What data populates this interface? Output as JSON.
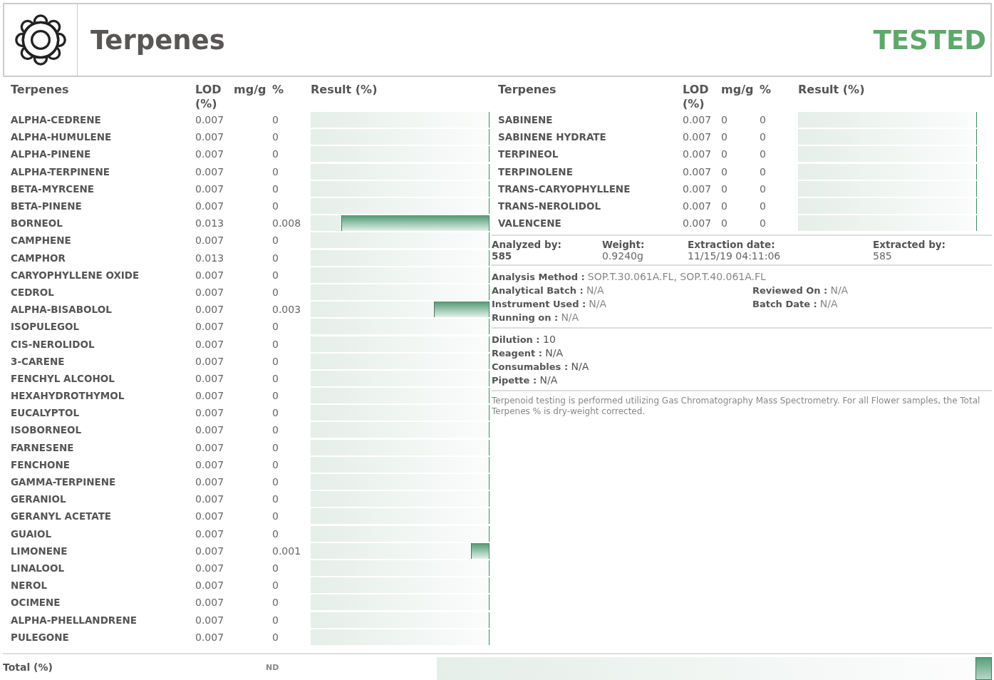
{
  "header": {
    "title": "Terpenes",
    "status": "TESTED"
  },
  "left_table": {
    "columns": [
      "Terpenes",
      "LOD (%)",
      "mg/g",
      "%",
      "Result (%)"
    ],
    "rows": [
      {
        "name": "ALPHA-CEDRENE",
        "lod": "0.007",
        "percent": "0"
      },
      {
        "name": "ALPHA-HUMULENE",
        "lod": "0.007",
        "percent": "0"
      },
      {
        "name": "ALPHA-PINENE",
        "lod": "0.007",
        "percent": "0"
      },
      {
        "name": "ALPHA-TERPINENE",
        "lod": "0.007",
        "percent": "0"
      },
      {
        "name": "BETA-MYRCENE",
        "lod": "0.007",
        "percent": "0"
      },
      {
        "name": "BETA-PINENE",
        "lod": "0.007",
        "percent": "0"
      },
      {
        "name": "BORNEOL",
        "lod": "0.013",
        "percent": "0.008",
        "level": 0.83
      },
      {
        "name": "CAMPHENE",
        "lod": "0.007",
        "percent": "0"
      },
      {
        "name": "CAMPHOR",
        "lod": "0.013",
        "percent": "0"
      },
      {
        "name": "CARYOPHYLLENE OXIDE",
        "lod": "0.007",
        "percent": "0"
      },
      {
        "name": "CEDROL",
        "lod": "0.007",
        "percent": "0"
      },
      {
        "name": "ALPHA-BISABOLOL",
        "lod": "0.007",
        "percent": "0.003",
        "level": 0.31
      },
      {
        "name": "ISOPULEGOL",
        "lod": "0.007",
        "percent": "0"
      },
      {
        "name": "CIS-NEROLIDOL",
        "lod": "0.007",
        "percent": "0"
      },
      {
        "name": "3-CARENE",
        "lod": "0.007",
        "percent": "0"
      },
      {
        "name": "FENCHYL ALCOHOL",
        "lod": "0.007",
        "percent": "0"
      },
      {
        "name": "HEXAHYDROTHYMOL",
        "lod": "0.007",
        "percent": "0"
      },
      {
        "name": "EUCALYPTOL",
        "lod": "0.007",
        "percent": "0"
      },
      {
        "name": "ISOBORNEOL",
        "lod": "0.007",
        "percent": "0"
      },
      {
        "name": "FARNESENE",
        "lod": "0.007",
        "percent": "0"
      },
      {
        "name": "FENCHONE",
        "lod": "0.007",
        "percent": "0"
      },
      {
        "name": "GAMMA-TERPINENE",
        "lod": "0.007",
        "percent": "0"
      },
      {
        "name": "GERANIOL",
        "lod": "0.007",
        "percent": "0"
      },
      {
        "name": "GERANYL ACETATE",
        "lod": "0.007",
        "percent": "0"
      },
      {
        "name": "GUAIOL",
        "lod": "0.007",
        "percent": "0"
      },
      {
        "name": "LIMONENE",
        "lod": "0.007",
        "percent": "0.001",
        "level": 0.1
      },
      {
        "name": "LINALOOL",
        "lod": "0.007",
        "percent": "0"
      },
      {
        "name": "NEROL",
        "lod": "0.007",
        "percent": "0"
      },
      {
        "name": "OCIMENE",
        "lod": "0.007",
        "percent": "0"
      },
      {
        "name": "ALPHA-PHELLANDRENE",
        "lod": "0.007",
        "percent": "0"
      },
      {
        "name": "PULEGONE",
        "lod": "0.007",
        "percent": "0"
      }
    ]
  },
  "right_table": {
    "columns": [
      "Terpenes",
      "LOD (%)",
      "mg/g",
      "%",
      "Result (%)"
    ],
    "rows": [
      {
        "name": "SABINENE",
        "lod": "0.007",
        "mg_g": "0",
        "percent": "0"
      },
      {
        "name": "SABINENE HYDRATE",
        "lod": "0.007",
        "mg_g": "0",
        "percent": "0"
      },
      {
        "name": "TERPINEOL",
        "lod": "0.007",
        "mg_g": "0",
        "percent": "0"
      },
      {
        "name": "TERPINOLENE",
        "lod": "0.007",
        "mg_g": "0",
        "percent": "0"
      },
      {
        "name": "TRANS-CARYOPHYLLENE",
        "lod": "0.007",
        "mg_g": "0",
        "percent": "0"
      },
      {
        "name": "TRANS-NEROLIDOL",
        "lod": "0.007",
        "mg_g": "0",
        "percent": "0"
      },
      {
        "name": "VALENCENE",
        "lod": "0.007",
        "mg_g": "0",
        "percent": "0"
      }
    ]
  },
  "sample_info": [
    {
      "label": "Analyzed by:",
      "value": "585",
      "kind": "bold"
    },
    {
      "label": "Weight:",
      "value": "0.9240g",
      "kind": "plain"
    },
    {
      "label": "Extraction date:",
      "value": "11/15/19 04:11:06",
      "kind": "plain"
    },
    {
      "label": "Extracted by:",
      "value": "585",
      "kind": "plain"
    }
  ],
  "method": {
    "analysis_method": {
      "label": "Analysis Method :",
      "value": "SOP.T.30.061A.FL, SOP.T.40.061A.FL"
    },
    "left": [
      {
        "label": "Analytical Batch :",
        "value": "N/A"
      },
      {
        "label": "Instrument Used :",
        "value": "N/A"
      },
      {
        "label": "Running on :",
        "value": "N/A"
      }
    ],
    "right": [
      {
        "label": "Reviewed On :",
        "value": "N/A"
      },
      {
        "label": "Batch Date :",
        "value": "N/A"
      }
    ]
  },
  "materials": [
    {
      "label": "Dilution :",
      "value": "10"
    },
    {
      "label": "Reagent :",
      "value": "N/A"
    },
    {
      "label": "Consumables :",
      "value": "N/A"
    },
    {
      "label": "Pipette :",
      "value": "N/A"
    }
  ],
  "note": "Terpenoid testing is performed utilizing Gas Chromatography Mass Spectrometry. For all Flower samples, the Total Terpenes % is dry-weight corrected.",
  "total": {
    "label": "Total (%)",
    "value": "ND",
    "level": 0.03
  }
}
